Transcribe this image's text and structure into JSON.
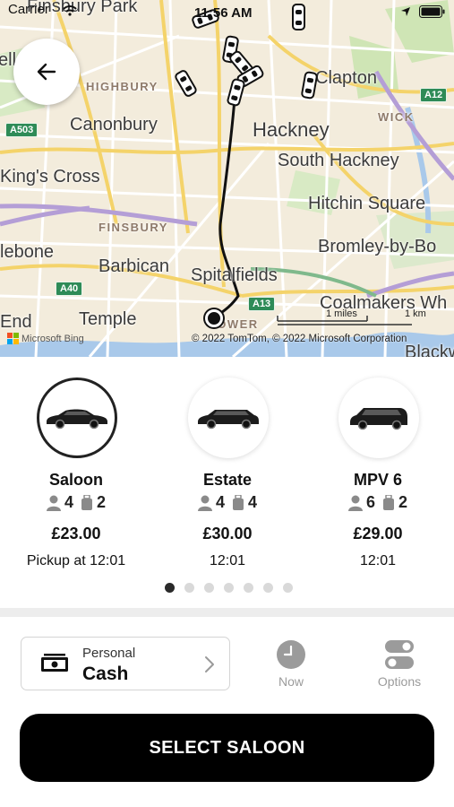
{
  "status_bar": {
    "carrier": "Carrier",
    "time": "11:56 AM"
  },
  "map": {
    "labels": {
      "finsbury_park": "Finsbury Park",
      "highbury": "HIGHBURY",
      "canonbury": "Canonbury",
      "kings_cross": "King's Cross",
      "finsbury": "FINSBURY",
      "barbican": "Barbican",
      "lebone": "lebone",
      "end": "End",
      "temple": "Temple",
      "hackney": "Hackney",
      "south_hackney": "South Hackney",
      "clapton": "Clapton",
      "wick": "WICK",
      "hitchin_square": "Hitchin Square",
      "bromley_by_bow": "Bromley-by-Bo",
      "spitalfields": "Spitalfields",
      "coalmakers": "Coalmakers Wh",
      "tower": "TOWER",
      "blackw": "Blackw",
      "ell": "ell",
      "west": "W"
    },
    "road_badges": {
      "a503": "A503",
      "a12": "A12",
      "a40": "A40",
      "a13": "A13"
    },
    "scale_miles": "1 miles",
    "scale_km": "1 km",
    "attribution": "© 2022 TomTom, © 2022 Microsoft Corporation",
    "provider": "Microsoft Bing"
  },
  "vehicles": [
    {
      "name": "Saloon",
      "passengers": "4",
      "bags": "2",
      "price": "£23.00",
      "pickup": "Pickup at 12:01",
      "selected": true
    },
    {
      "name": "Estate",
      "passengers": "4",
      "bags": "4",
      "price": "£30.00",
      "pickup": "12:01",
      "selected": false
    },
    {
      "name": "MPV 6",
      "passengers": "6",
      "bags": "2",
      "price": "£29.00",
      "pickup": "12:01",
      "selected": false
    }
  ],
  "pagination": {
    "total": 7,
    "active": 0
  },
  "payment": {
    "type": "Personal",
    "method": "Cash"
  },
  "actions": {
    "now_label": "Now",
    "options_label": "Options"
  },
  "cta": {
    "label": "SELECT SALOON"
  },
  "colors": {
    "accent": "#000000",
    "road_badge": "#2e8b57",
    "map_bg": "#f4eee1"
  }
}
